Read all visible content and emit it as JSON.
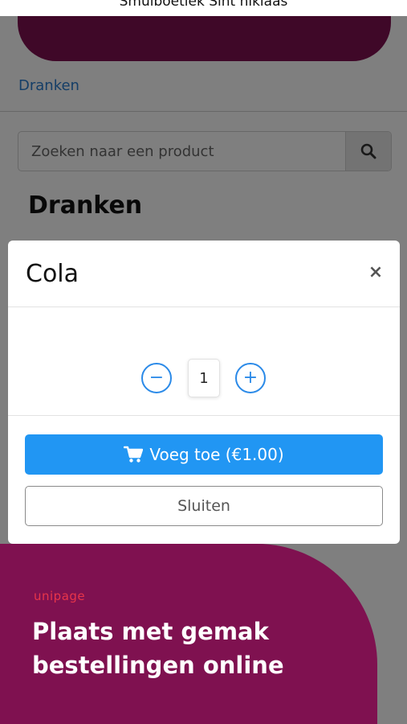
{
  "app": {
    "title": "Smulboetiek Sint niklaas"
  },
  "breadcrumb": {
    "label": "Dranken"
  },
  "search": {
    "placeholder": "Zoeken naar een product",
    "icon": "search-icon"
  },
  "section": {
    "title": "Dranken"
  },
  "modal": {
    "title": "Cola",
    "close_symbol": "×",
    "quantity": {
      "minus": "−",
      "value": "1",
      "plus": "+"
    },
    "add_button_label": "Voeg toe (€1.00)",
    "close_button_label": "Sluiten"
  },
  "promo": {
    "logo": "unipage",
    "headline_line1": "Plaats met gemak",
    "headline_line2": "bestellingen online"
  },
  "colors": {
    "brand": "#7f1150",
    "accent": "#2196f3",
    "link": "#2a7dcf",
    "logo": "#e8354a"
  }
}
